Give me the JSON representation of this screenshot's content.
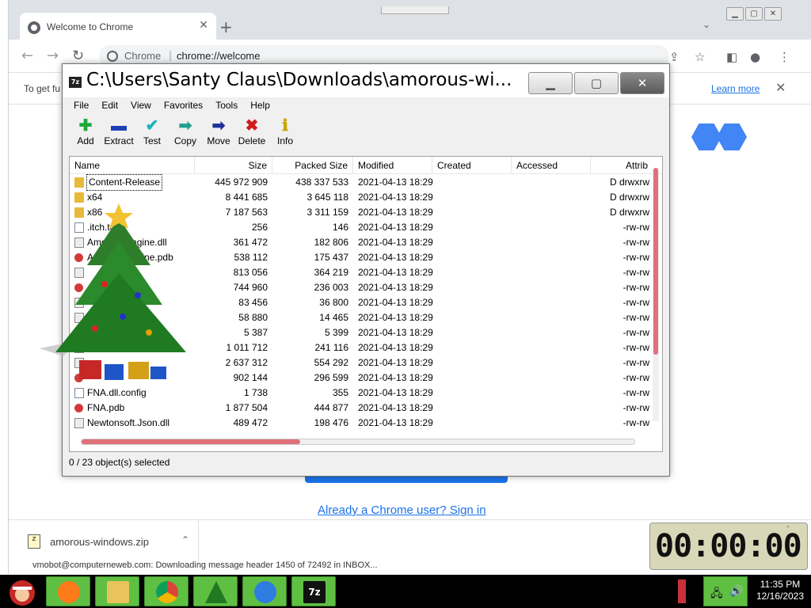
{
  "chrome": {
    "tab_title": "Welcome to Chrome",
    "site_label": "Chrome",
    "url": "chrome://welcome",
    "info_text": "To get fu",
    "learn_more": "Learn more",
    "signin_text": "Already a Chrome user? Sign in",
    "download_file": "amorous-windows.zip",
    "status_line": "vmobot@computerneweb.com: Downloading message header 1450 of 72492 in INBOX..."
  },
  "zip": {
    "title": "C:\\Users\\Santy Claus\\Downloads\\amorous-wi...",
    "menu": [
      "File",
      "Edit",
      "View",
      "Favorites",
      "Tools",
      "Help"
    ],
    "toolbar": [
      {
        "label": "Add",
        "icon": "plus-icon",
        "color": "#1ea83a"
      },
      {
        "label": "Extract",
        "icon": "minus-icon",
        "color": "#1d3fb8"
      },
      {
        "label": "Test",
        "icon": "check-icon",
        "color": "#19b3b8"
      },
      {
        "label": "Copy",
        "icon": "arrow-right-icon",
        "color": "#21a090"
      },
      {
        "label": "Move",
        "icon": "arrow-right-icon",
        "color": "#1d2f9a"
      },
      {
        "label": "Delete",
        "icon": "x-icon",
        "color": "#d21b1b"
      },
      {
        "label": "Info",
        "icon": "info-icon",
        "color": "#c9a400"
      }
    ],
    "columns": [
      "Name",
      "Size",
      "Packed Size",
      "Modified",
      "Created",
      "Accessed",
      "Attrib"
    ],
    "rows": [
      {
        "name": "Content-Release",
        "size": "445 972 909",
        "packed": "438 337 533",
        "modified": "2021-04-13 18:29",
        "attrib": "D drwxrw",
        "type": "folder"
      },
      {
        "name": "x64",
        "size": "8 441 685",
        "packed": "3 645 118",
        "modified": "2021-04-13 18:29",
        "attrib": "D drwxrw",
        "type": "folder"
      },
      {
        "name": "x86",
        "size": "7 187 563",
        "packed": "3 311 159",
        "modified": "2021-04-13 18:29",
        "attrib": "D drwxrw",
        "type": "folder"
      },
      {
        "name": ".itch.toml",
        "size": "256",
        "packed": "146",
        "modified": "2021-04-13 18:29",
        "attrib": "-rw-rw",
        "type": "file"
      },
      {
        "name": "AmorousEngine.dll",
        "size": "361 472",
        "packed": "182 806",
        "modified": "2021-04-13 18:29",
        "attrib": "-rw-rw",
        "type": "dll"
      },
      {
        "name": "AmorousEngine.pdb",
        "size": "538 112",
        "packed": "175 437",
        "modified": "2021-04-13 18:29",
        "attrib": "-rw-rw",
        "type": "pdb"
      },
      {
        "name": "",
        "size": "813 056",
        "packed": "364 219",
        "modified": "2021-04-13 18:29",
        "attrib": "-rw-rw",
        "type": "dll"
      },
      {
        "name": "",
        "size": "744 960",
        "packed": "236 003",
        "modified": "2021-04-13 18:29",
        "attrib": "-rw-rw",
        "type": "pdb"
      },
      {
        "name": "",
        "size": "83 456",
        "packed": "36 800",
        "modified": "2021-04-13 18:29",
        "attrib": "-rw-rw",
        "type": "dll"
      },
      {
        "name": "",
        "size": "58 880",
        "packed": "14 465",
        "modified": "2021-04-13 18:29",
        "attrib": "-rw-rw",
        "type": "dll"
      },
      {
        "name": "",
        "size": "5 387",
        "packed": "5 399",
        "modified": "2021-04-13 18:29",
        "attrib": "-rw-rw",
        "type": "file"
      },
      {
        "name": "",
        "size": "1 011 712",
        "packed": "241 116",
        "modified": "2021-04-13 18:29",
        "attrib": "-rw-rw",
        "type": "dll"
      },
      {
        "name": "",
        "size": "2 637 312",
        "packed": "554 292",
        "modified": "2021-04-13 18:29",
        "attrib": "-rw-rw",
        "type": "dll"
      },
      {
        "name": "",
        "size": "902 144",
        "packed": "296 599",
        "modified": "2021-04-13 18:29",
        "attrib": "-rw-rw",
        "type": "pdb"
      },
      {
        "name": "FNA.dll.config",
        "size": "1 738",
        "packed": "355",
        "modified": "2021-04-13 18:29",
        "attrib": "-rw-rw",
        "type": "file"
      },
      {
        "name": "FNA.pdb",
        "size": "1 877 504",
        "packed": "444 877",
        "modified": "2021-04-13 18:29",
        "attrib": "-rw-rw",
        "type": "pdb"
      },
      {
        "name": "Newtonsoft.Json.dll",
        "size": "489 472",
        "packed": "198 476",
        "modified": "2021-04-13 18:29",
        "attrib": "-rw-rw",
        "type": "dll"
      }
    ],
    "status": "0 / 23 object(s) selected"
  },
  "timer": {
    "display": "00:00:00"
  },
  "taskbar": {
    "time": "11:35 PM",
    "date": "12/16/2023"
  }
}
